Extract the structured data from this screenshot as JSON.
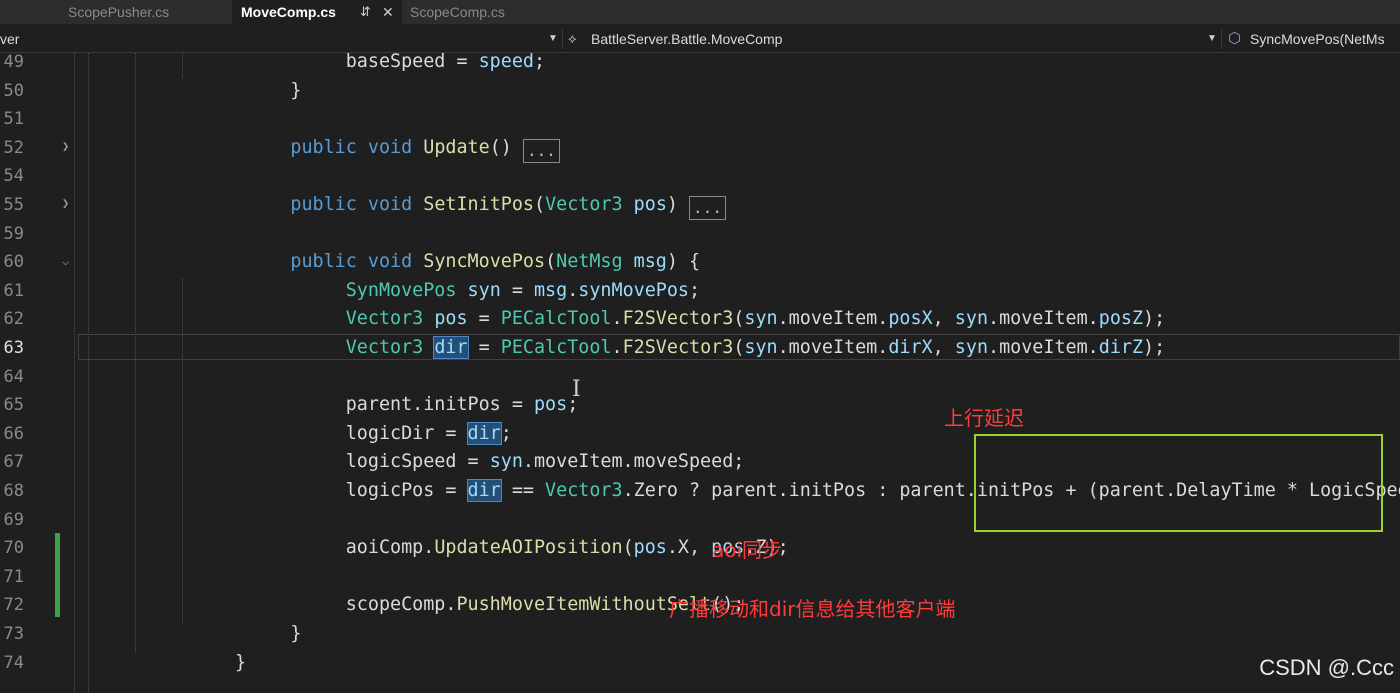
{
  "tabs": [
    {
      "label": "ScopePusher.cs",
      "active": false
    },
    {
      "label": "MoveComp.cs",
      "active": true,
      "pin_icon": "pin-icon",
      "close_icon": "close-icon"
    },
    {
      "label": "ScopeComp.cs",
      "active": false
    }
  ],
  "navbar": {
    "project": "ver",
    "class_icon": "class-icon",
    "class_path": "BattleServer.Battle.MoveComp",
    "method_icon": "method-cube-icon",
    "method": "SyncMovePos(NetMs"
  },
  "line_numbers": [
    "49",
    "50",
    "51",
    "52",
    "54",
    "55",
    "59",
    "60",
    "61",
    "62",
    "63",
    "64",
    "65",
    "66",
    "67",
    "68",
    "69",
    "70",
    "71",
    "72",
    "73",
    "74"
  ],
  "current_line": "63",
  "code": {
    "l49": {
      "a": "baseSpeed",
      "b": " = ",
      "c": "speed",
      "d": ";"
    },
    "l50": "}",
    "l52": {
      "kw1": "public",
      "kw2": "void",
      "fn": "Update",
      "rest": "()",
      "collapsed": "..."
    },
    "l55": {
      "kw1": "public",
      "kw2": "void",
      "fn": "SetInitPos",
      "p1": "(",
      "ty": "Vector3",
      "var": "pos",
      "p2": ")",
      "collapsed": "..."
    },
    "l60": {
      "kw1": "public",
      "kw2": "void",
      "fn": "SyncMovePos",
      "p1": "(",
      "ty": "NetMsg",
      "var": "msg",
      "p2": ") {"
    },
    "l61": {
      "ty": "SynMovePos",
      "v1": "syn",
      "eq": " = ",
      "v2": "msg",
      "dot": ".",
      "v3": "synMovePos",
      "end": ";"
    },
    "l62": {
      "ty": "Vector3",
      "v1": "pos",
      "eq": " = ",
      "cls": "PECalcTool",
      "dot": ".",
      "fn": "F2SVector3",
      "o": "(",
      "a1": "syn",
      "a2": ".moveItem.",
      "a3": "posX",
      "c": ", ",
      "a4": "syn",
      "a5": ".moveItem.",
      "a6": "posZ",
      "end": ");"
    },
    "l63": {
      "ty": "Vector3",
      "v1": "dir",
      "eq": " = ",
      "cls": "PECalcTool",
      "dot": ".",
      "fn": "F2SVector3",
      "o": "(",
      "a1": "syn",
      "a2": ".moveItem.",
      "a3": "dirX",
      "c": ", ",
      "a4": "syn",
      "a5": ".moveItem.",
      "a6": "dirZ",
      "end": ");"
    },
    "l65": {
      "a": "parent.initPos",
      "eq": " = ",
      "b": "pos",
      "end": ";"
    },
    "l66": {
      "a": "logicDir",
      "eq": " = ",
      "b": "dir",
      "end": ";"
    },
    "l67": {
      "a": "logicSpeed",
      "eq": " = ",
      "b": "syn",
      "c": ".moveItem.moveSpeed",
      "end": ";"
    },
    "l68": {
      "a": "logicPos",
      "eq": " = ",
      "b": "dir",
      "op": " == ",
      "ty": "Vector3",
      "c": ".Zero ? parent.initPos : parent.initPos + (parent.DelayTime * LogicSpeed * L"
    },
    "l70": {
      "a": "aoiComp",
      "dot": ".",
      "fn": "UpdateAOIPosition",
      "o": "(",
      "b": "pos",
      "c": ".X, ",
      "d": "pos",
      "e": ".Z);"
    },
    "l72": {
      "a": "scopeComp",
      "dot": ".",
      "fn": "PushMoveItemWithoutSelt",
      "end": "();"
    },
    "l73": "}",
    "l74": "}"
  },
  "annotations": {
    "uplink_delay": "上行延迟",
    "aoi_sync": "aoi同步",
    "broadcast": "广播移动和dir信息给其他客户端"
  },
  "watermark": "CSDN @.Ccc",
  "colors": {
    "annotation": "#ff3b3b",
    "highlight_box": "#9fcf2f",
    "change_bar": "#3fa04a"
  }
}
